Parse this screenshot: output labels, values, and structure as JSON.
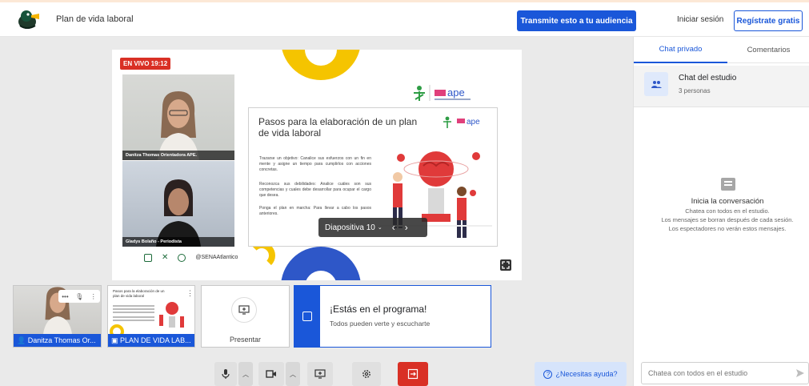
{
  "header": {
    "studio_name": "Plan de vida laboral",
    "broadcast_label": "Transmite esto a tu audiencia",
    "login_label": "Iniciar sesión",
    "register_label": "Regístrate gratis"
  },
  "stage": {
    "live_label": "EN VIVO 19:12",
    "cameras": [
      {
        "label": "Danitza Thomas Orientadora APE."
      },
      {
        "label": "Gladys Bolaño - Periodista"
      }
    ],
    "slide": {
      "title": "Pasos para la elaboración de un plan de vida laboral",
      "paragraphs": [
        "Trazarse un objetivo: Canalice sus esfuerzos con un fin en mente y asigne un tiempo para cumplirlos con acciones concretas.",
        "Reconozca sus debilidades: Analice cuáles son sus competencias y cuales debe desarrollar para ocupar el cargo que desea.",
        "Ponga el plan en marcha: Para llevar a cabo los pasos anteriores."
      ],
      "footer_handle": "@SENAAtlantico"
    },
    "slide_control": "Diapositiva 10"
  },
  "thumbnails": {
    "speaker_label": "Danitza Thomas Or...",
    "slides_label": "PLAN DE VIDA LAB...",
    "slides_mini_title": "Pasos para la elaboración de un plan de vida laboral",
    "present_label": "Presentar"
  },
  "banner": {
    "title": "¡Estás en el programa!",
    "subtitle": "Todos pueden verte y escucharte"
  },
  "help_label": "¿Necesitas ayuda?",
  "panel": {
    "tabs": [
      "Chat privado",
      "Comentarios"
    ],
    "room_title": "Chat del estudio",
    "room_sub": "3 personas",
    "empty_title": "Inicia la conversación",
    "empty_lines": [
      "Chatea con todos en el estudio.",
      "Los mensajes se borran después de cada sesión.",
      "Los espectadores no verán estos mensajes."
    ],
    "input_placeholder": "Chatea con todos en el estudio"
  },
  "colors": {
    "accent": "#1a57d9",
    "live_red": "#d93025",
    "yellow": "#f5c400"
  }
}
